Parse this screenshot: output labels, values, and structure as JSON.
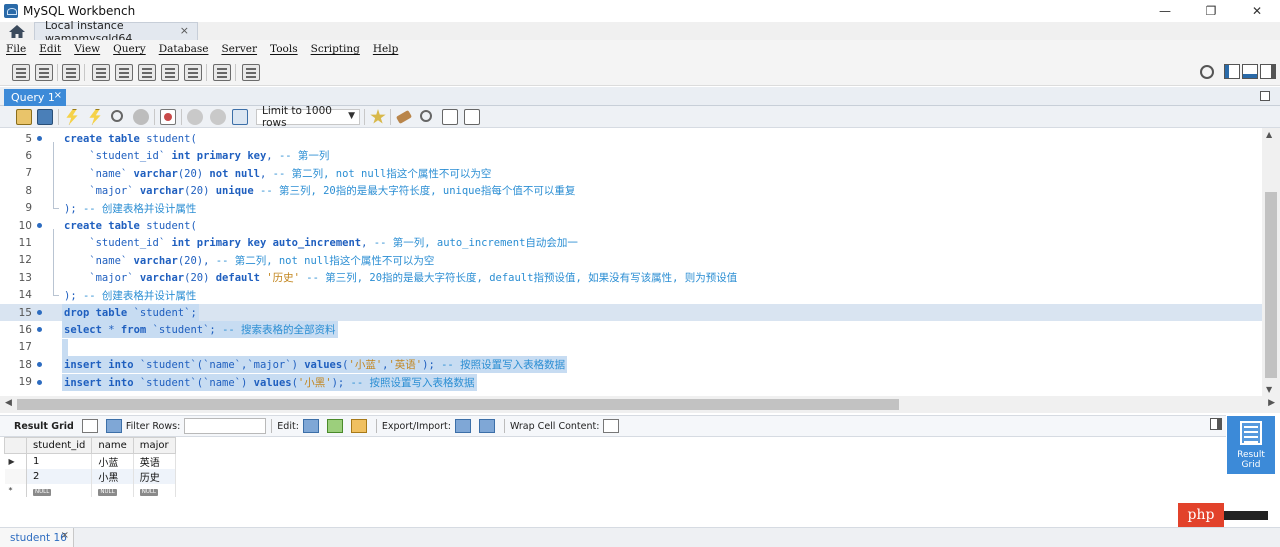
{
  "window": {
    "title": "MySQL Workbench",
    "controls": [
      "—",
      "❐",
      "✕"
    ]
  },
  "connection_tab": {
    "label": "Local instance wampmysqld64",
    "close": "×"
  },
  "menu": [
    "File",
    "Edit",
    "View",
    "Query",
    "Database",
    "Server",
    "Tools",
    "Scripting",
    "Help"
  ],
  "query_tab": {
    "label": "Query 1",
    "close": "×"
  },
  "sql_toolbar": {
    "limit_label": "Limit to 1000 rows",
    "limit_arrow": "▼"
  },
  "editor": {
    "lines": [
      {
        "num": "5",
        "marker": true,
        "tokens": [
          [
            "kw",
            "create table "
          ],
          [
            "txt",
            "student("
          ]
        ]
      },
      {
        "num": "6",
        "marker": false,
        "tokens": [
          [
            "txt",
            "    `student_id` "
          ],
          [
            "kw",
            "int primary key"
          ],
          [
            "txt",
            ", "
          ],
          [
            "cm",
            "-- 第一列"
          ]
        ]
      },
      {
        "num": "7",
        "marker": false,
        "tokens": [
          [
            "txt",
            "    `name` "
          ],
          [
            "kw",
            "varchar"
          ],
          [
            "txt",
            "(20) "
          ],
          [
            "kw",
            "not null"
          ],
          [
            "txt",
            ", "
          ],
          [
            "cm",
            "-- 第二列, not null指这个属性不可以为空"
          ]
        ]
      },
      {
        "num": "8",
        "marker": false,
        "tokens": [
          [
            "txt",
            "    `major` "
          ],
          [
            "kw",
            "varchar"
          ],
          [
            "txt",
            "(20) "
          ],
          [
            "kw",
            "unique"
          ],
          [
            "txt",
            " "
          ],
          [
            "cm",
            "-- 第三列, 20指的是最大字符长度, unique指每个值不可以重复"
          ]
        ]
      },
      {
        "num": "9",
        "marker": false,
        "tokens": [
          [
            "txt",
            "); "
          ],
          [
            "cm",
            "-- 创建表格并设计属性"
          ]
        ]
      },
      {
        "num": "10",
        "marker": true,
        "tokens": [
          [
            "kw",
            "create table "
          ],
          [
            "txt",
            "student("
          ]
        ]
      },
      {
        "num": "11",
        "marker": false,
        "tokens": [
          [
            "txt",
            "    `student_id` "
          ],
          [
            "kw",
            "int primary key auto_increment"
          ],
          [
            "txt",
            ", "
          ],
          [
            "cm",
            "-- 第一列, auto_increment自动会加一"
          ]
        ]
      },
      {
        "num": "12",
        "marker": false,
        "tokens": [
          [
            "txt",
            "    `name` "
          ],
          [
            "kw",
            "varchar"
          ],
          [
            "txt",
            "(20), "
          ],
          [
            "cm",
            "-- 第二列, not null指这个属性不可以为空"
          ]
        ]
      },
      {
        "num": "13",
        "marker": false,
        "tokens": [
          [
            "txt",
            "    `major` "
          ],
          [
            "kw",
            "varchar"
          ],
          [
            "txt",
            "(20) "
          ],
          [
            "kw",
            "default "
          ],
          [
            "str",
            "'历史'"
          ],
          [
            "txt",
            " "
          ],
          [
            "cm",
            "-- 第三列, 20指的是最大字符长度, default指预设值, 如果没有写该属性, 则为预设值"
          ]
        ]
      },
      {
        "num": "14",
        "marker": false,
        "tokens": [
          [
            "txt",
            "); "
          ],
          [
            "cm",
            "-- 创建表格并设计属性"
          ]
        ]
      },
      {
        "num": "15",
        "marker": true,
        "tokens": [
          [
            "kw",
            "drop table "
          ],
          [
            "txt",
            "`student`;"
          ]
        ]
      },
      {
        "num": "16",
        "marker": true,
        "tokens": [
          [
            "kw",
            "select "
          ],
          [
            "txt",
            "* "
          ],
          [
            "kw",
            "from "
          ],
          [
            "txt",
            "`student`; "
          ],
          [
            "cm",
            "-- 搜索表格的全部资料"
          ]
        ]
      },
      {
        "num": "17",
        "marker": false,
        "tokens": []
      },
      {
        "num": "18",
        "marker": true,
        "tokens": [
          [
            "kw",
            "insert into "
          ],
          [
            "txt",
            "`student`(`name`,`major`) "
          ],
          [
            "kw",
            "values"
          ],
          [
            "txt",
            "("
          ],
          [
            "str",
            "'小蓝'"
          ],
          [
            "txt",
            ","
          ],
          [
            "str",
            "'英语'"
          ],
          [
            "txt",
            "); "
          ],
          [
            "cm",
            "-- 按照设置写入表格数据"
          ]
        ]
      },
      {
        "num": "19",
        "marker": true,
        "tokens": [
          [
            "kw",
            "insert into "
          ],
          [
            "txt",
            "`student`(`name`) "
          ],
          [
            "kw",
            "values"
          ],
          [
            "txt",
            "("
          ],
          [
            "str",
            "'小黑'"
          ],
          [
            "txt",
            "); "
          ],
          [
            "cm",
            "-- 按照设置写入表格数据"
          ]
        ]
      }
    ]
  },
  "result_toolbar": {
    "result_grid": "Result Grid",
    "filter_rows": "Filter Rows:",
    "filter_value": "",
    "edit": "Edit:",
    "export_import": "Export/Import:",
    "wrap": "Wrap Cell Content:"
  },
  "result_side": {
    "line1": "Result",
    "line2": "Grid"
  },
  "result_table": {
    "columns": [
      "student_id",
      "name",
      "major"
    ],
    "rows": [
      {
        "gutter": "▶",
        "cells": [
          "1",
          "小蓝",
          "英语"
        ]
      },
      {
        "gutter": "",
        "cells": [
          "2",
          "小黑",
          "历史"
        ]
      }
    ],
    "null_label": "NULL",
    "new_row_marker": "*"
  },
  "bottom_tab": {
    "label": "student 16",
    "close": "×"
  },
  "watermark": {
    "text": "php"
  }
}
